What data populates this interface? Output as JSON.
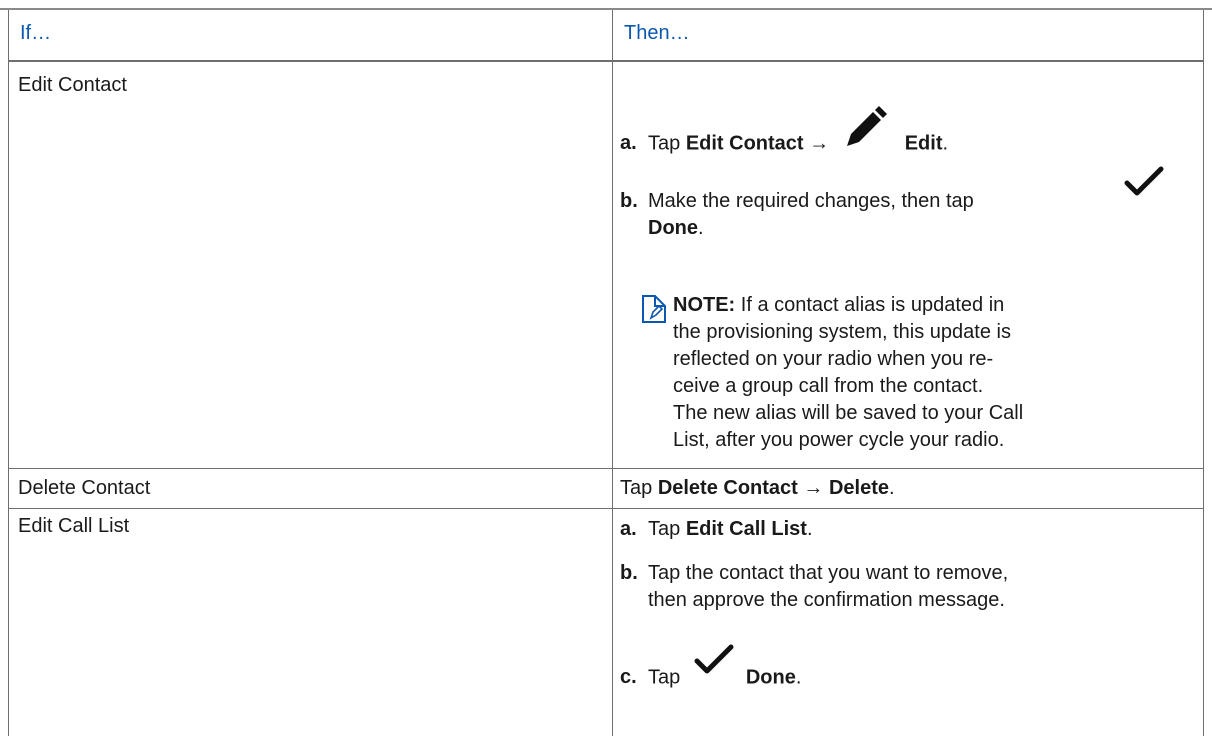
{
  "table": {
    "header": {
      "if_label": "If…",
      "then_label": "Then…"
    },
    "rows": [
      {
        "if": "Edit Contact",
        "steps": [
          {
            "letter": "a.",
            "pre": "Tap ",
            "bold1": "Edit Contact",
            "mid": " → ",
            "icon": "pencil-icon",
            "bold2": "Edit",
            "post": "."
          },
          {
            "letter": "b.",
            "text": "Make the required changes, then tap",
            "icon": "checkmark-icon",
            "bold": "Done",
            "post": "."
          }
        ],
        "note": {
          "icon": "note-icon",
          "label": "NOTE:",
          "lines": [
            "If a contact alias is updated in",
            "the provisioning system, this update is",
            "reflected on your radio when you re-",
            "ceive a group call from the contact.",
            "The new alias will be saved to your Call",
            "List, after you power cycle your radio."
          ]
        }
      },
      {
        "if": "Delete Contact",
        "then": {
          "pre": "Tap ",
          "bold1": "Delete Contact",
          "mid": " → ",
          "bold2": "Delete",
          "post": "."
        }
      },
      {
        "if": "Edit Call List",
        "steps": [
          {
            "letter": "a.",
            "pre": "Tap ",
            "bold": "Edit Call List",
            "post": "."
          },
          {
            "letter": "b.",
            "line1": "Tap the contact that you want to remove,",
            "line2": "then approve the confirmation message."
          },
          {
            "letter": "c.",
            "pre": "Tap",
            "icon": "checkmark-icon",
            "bold": "Done",
            "post": "."
          }
        ]
      }
    ]
  }
}
